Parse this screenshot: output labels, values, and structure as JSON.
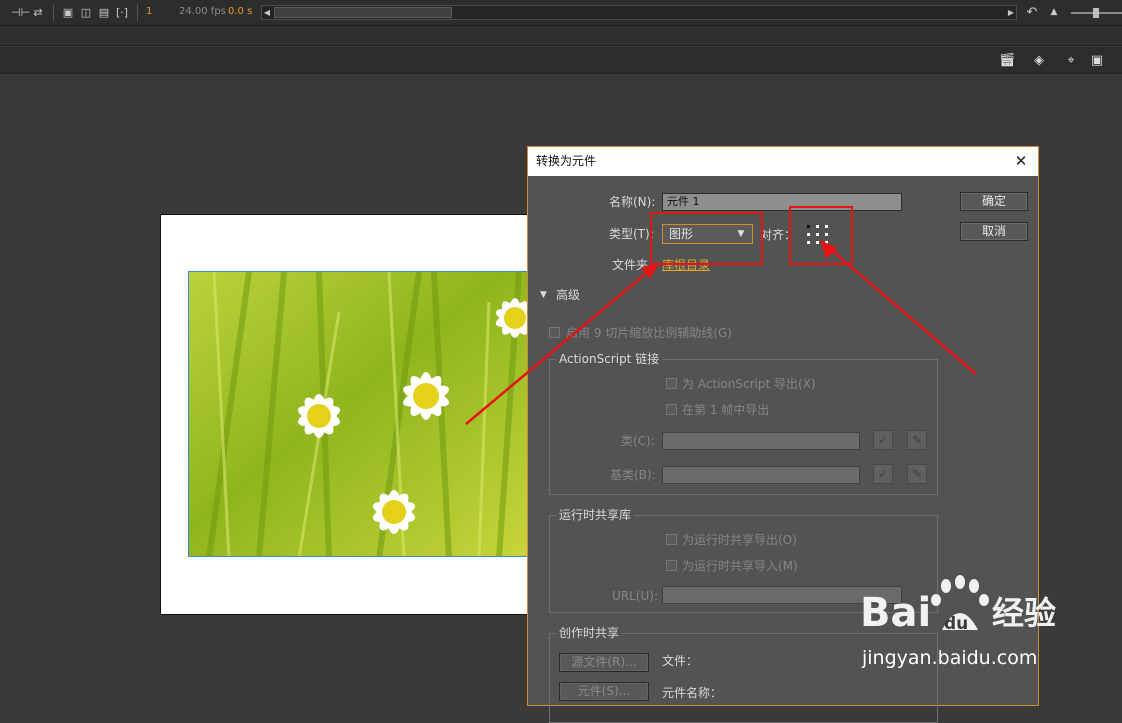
{
  "timeline": {
    "frame_number": "1",
    "fps": "24.00 fps",
    "elapsed": "0.0 s"
  },
  "dialog": {
    "title": "转换为元件",
    "name_label": "名称(N):",
    "name_value": "元件 1",
    "type_label": "类型(T):",
    "type_value": "图形",
    "align_label": "对齐：",
    "folder_label": "文件夹：",
    "folder_value": "库根目录",
    "ok_label": "确定",
    "cancel_label": "取消",
    "advanced_label": "高级",
    "nine_slice_label": "启用 9 切片缩放比例辅助线(G)",
    "as_linkage": {
      "title": "ActionScript 链接",
      "export_for_as": "为 ActionScript 导出(X)",
      "export_in_frame": "在第 1 帧中导出",
      "class_label": "类(C):",
      "base_class_label": "基类(B):"
    },
    "runtime_shared": {
      "title": "运行时共享库",
      "export_runtime": "为运行时共享导出(O)",
      "import_runtime": "为运行时共享导入(M)",
      "url_label": "URL(U):"
    },
    "authortime_shared": {
      "title": "创作时共享",
      "source_file_button": "源文件(R)...",
      "file_label": "文件：",
      "symbol_button": "元件(S)...",
      "symbol_name_label": "元件名称："
    }
  },
  "watermark": {
    "brand_text": "Bai",
    "brand_du": "du",
    "brand_cn": "经验",
    "url": "jingyan.baidu.com"
  },
  "colors": {
    "annotation_red": "#e21414",
    "dialog_border": "#cf8a3b",
    "folder_link": "#e0a62d"
  }
}
